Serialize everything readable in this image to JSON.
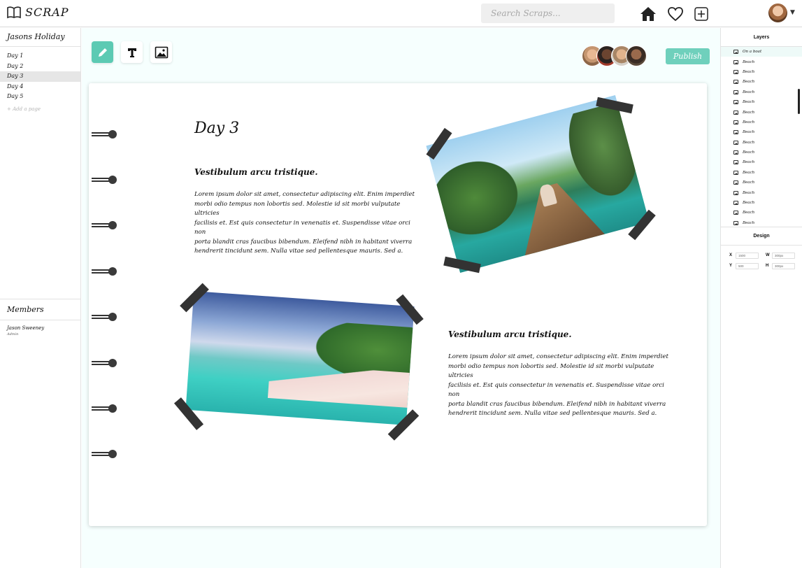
{
  "app": {
    "name": "SCRAP",
    "search_placeholder": "Search Scraps...",
    "icons": [
      "book-icon",
      "home-icon",
      "heart-icon",
      "add-square-icon",
      "chevron-down-icon"
    ]
  },
  "sidebar": {
    "title": "Jasons Holiday",
    "days": [
      "Day 1",
      "Day 2",
      "Day 3",
      "Day 4",
      "Day 5"
    ],
    "active_day": "Day 3",
    "add_page": "+ Add a page",
    "members_title": "Members",
    "members": [
      {
        "name": "Jason Sweeney",
        "role": "Admin"
      }
    ]
  },
  "toolbar": {
    "tools": [
      "pencil-icon",
      "text-icon",
      "image-icon"
    ],
    "active_tool": "pencil-icon",
    "publish_label": "Publish",
    "collaborator_count": 4
  },
  "page": {
    "title": "Day 3",
    "sections": [
      {
        "heading": "Vestibulum arcu tristique.",
        "lines": [
          "Lorem ipsum dolor sit amet, consectetur adipiscing elit. Enim imperdiet",
          "morbi odio tempus non lobortis sed. Molestie id sit morbi vulputate ultricies",
          "facilisis et. Est quis consectetur in venenatis et. Suspendisse vitae orci non",
          "porta blandit cras faucibus bibendum. Eleifend nibh in habitant viverra",
          "hendrerit tincidunt sem. Nulla vitae sed pellentesque mauris. Sed a."
        ]
      },
      {
        "heading": "Vestibulum arcu tristique.",
        "lines": [
          "Lorem ipsum dolor sit amet, consectetur adipiscing elit. Enim imperdiet",
          "morbi odio tempus non lobortis sed. Molestie id sit morbi vulputate ultricies",
          "facilisis et. Est quis consectetur in venenatis et. Suspendisse vitae orci non",
          "porta blandit cras faucibus bibendum. Eleifend nibh in habitant viverra",
          "hendrerit tincidunt sem. Nulla vitae sed pellentesque mauris. Sed a."
        ]
      }
    ],
    "photos": [
      "boat-in-lagoon-photo",
      "tropical-beach-photo"
    ]
  },
  "layers": {
    "title": "Layers",
    "items": [
      "On a boat",
      "Beach",
      "Beach",
      "Beach",
      "Beach",
      "Beach",
      "Beach",
      "Beach",
      "Beach",
      "Beach",
      "Beach",
      "Beach",
      "Beach",
      "Beach",
      "Beach",
      "Beach",
      "Beach",
      "Beach"
    ]
  },
  "design": {
    "title": "Design",
    "x_label": "X",
    "x_value": "1500",
    "w_label": "W",
    "w_value": "300px",
    "y_label": "Y",
    "y_value": "500",
    "h_label": "H",
    "h_value": "300px"
  },
  "colors": {
    "accent": "#5ccab3",
    "canvas_bg": "#f6fffe",
    "tape": "#333333"
  }
}
